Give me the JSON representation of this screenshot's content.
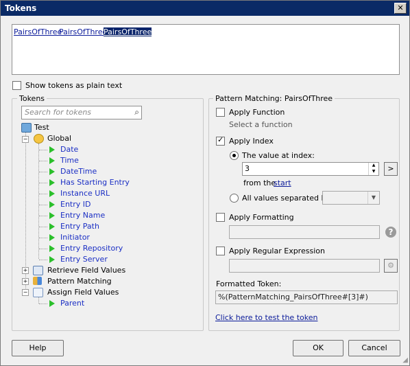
{
  "window": {
    "title": "Tokens",
    "close_glyph": "✕"
  },
  "token_box": {
    "tokens": [
      "PairsOfThree",
      "PairsOfThree",
      "PairsOfThree"
    ]
  },
  "show_plain": {
    "label": "Show tokens as plain text",
    "checked": false
  },
  "tokens_panel": {
    "label": "Tokens",
    "search_placeholder": "Search for tokens",
    "tree": {
      "root": "Test",
      "global": "Global",
      "global_items": [
        "Date",
        "Time",
        "DateTime",
        "Has Starting Entry",
        "Instance URL",
        "Entry ID",
        "Entry Name",
        "Entry Path",
        "Initiator",
        "Entry Repository",
        "Entry Server"
      ],
      "retrieve": "Retrieve Field Values",
      "pattern": "Pattern Matching",
      "assign": "Assign Field Values",
      "assign_items": [
        "Parent"
      ]
    }
  },
  "pattern_panel": {
    "label": "Pattern Matching: PairsOfThree",
    "apply_function": {
      "label": "Apply Function",
      "checked": false,
      "hint": "Select a function"
    },
    "apply_index": {
      "label": "Apply Index",
      "checked": true
    },
    "value_at_index": {
      "label": "The value at index:",
      "selected": true,
      "value": "3",
      "from_the": "from the",
      "start_link": "start",
      "arrow": ">"
    },
    "all_values": {
      "label": "All values separated by:",
      "selected": false,
      "value": ""
    },
    "apply_formatting": {
      "label": "Apply Formatting",
      "checked": false,
      "value": "",
      "help_glyph": "?"
    },
    "apply_regex": {
      "label": "Apply Regular Expression",
      "checked": false,
      "value": ""
    },
    "formatted_token": {
      "label": "Formatted Token:",
      "value": "%(PatternMatching_PairsOfThree#[3]#)"
    },
    "test_link": "Click here to test the token"
  },
  "buttons": {
    "help": "Help",
    "ok": "OK",
    "cancel": "Cancel"
  },
  "colors": {
    "title_bar": "#0a2a66",
    "link": "#0a1a99",
    "tree_leaf": "#1a2ec4",
    "arrow_green": "#2bbf2b"
  }
}
